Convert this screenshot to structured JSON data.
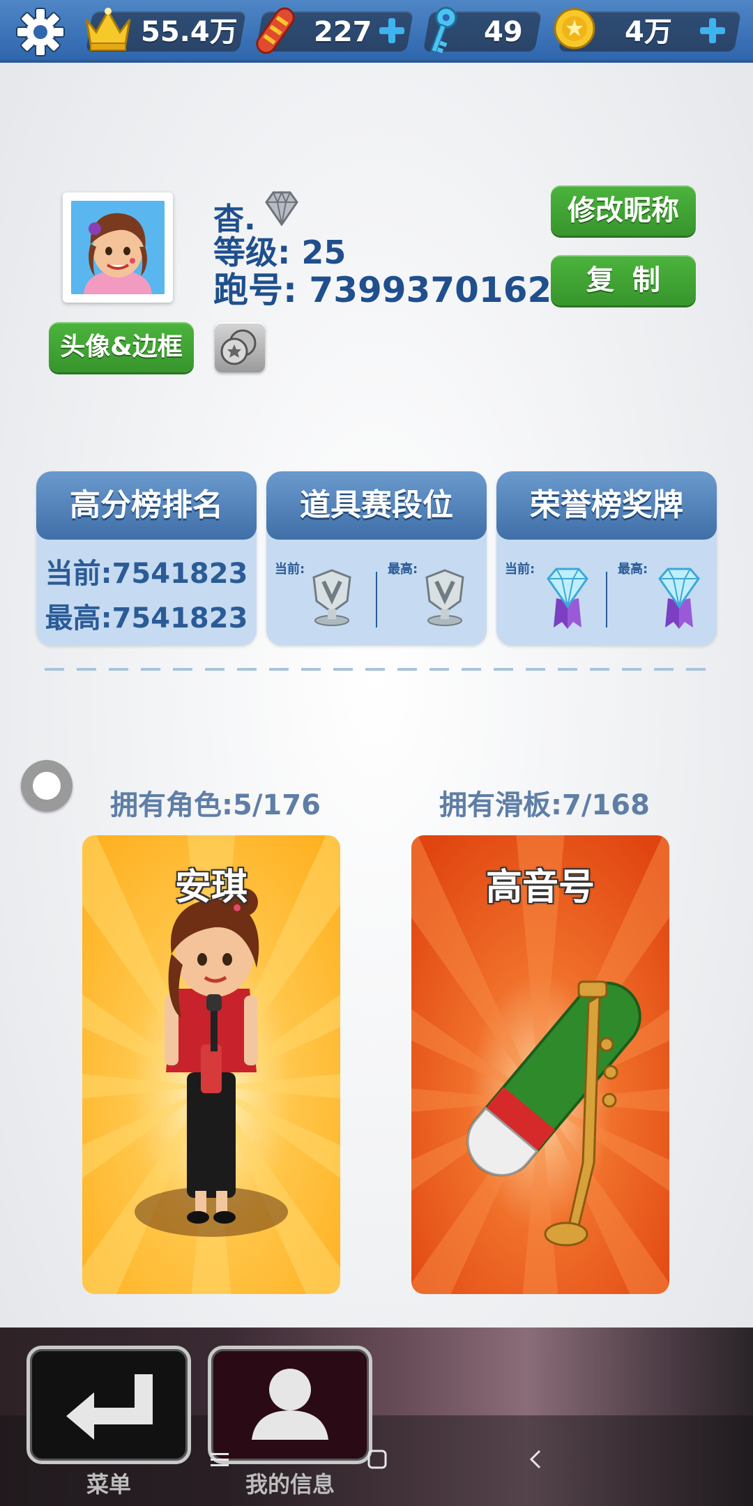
{
  "topbar": {
    "crowns": "55.4万",
    "boards": "227",
    "keys": "49",
    "coins": "4万"
  },
  "profile": {
    "name": "杳.",
    "level": "等级: 25",
    "player_id": "跑号: 7399370162",
    "rename_label": "修改昵称",
    "copy_label": "复制",
    "frame_label": "头像&边框"
  },
  "cards": {
    "highscore": {
      "title": "高分榜排名",
      "current": "当前:7541823",
      "best": "最高:7541823"
    },
    "powerup": {
      "title": "道具赛段位",
      "current_label": "当前:",
      "best_label": "最高:"
    },
    "honor": {
      "title": "荣誉榜奖牌",
      "current_label": "当前:",
      "best_label": "最高:"
    }
  },
  "owned": {
    "characters": "拥有角色:5/176",
    "boards": "拥有滑板:7/168",
    "character_name": "安琪",
    "board_name": "高音号"
  },
  "bottom": {
    "menu_label": "菜单",
    "me_label": "我的信息"
  },
  "colors": {
    "accent_blue": "#1f4f8d",
    "button_green": "#3fa534",
    "card_bg": "#c6dbf1"
  }
}
